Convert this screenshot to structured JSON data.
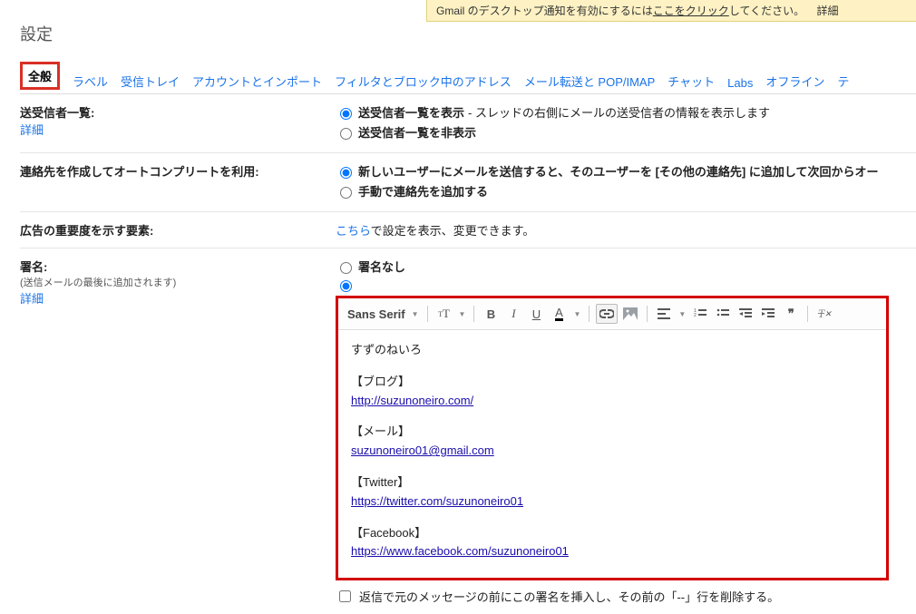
{
  "notif": {
    "prefix": "Gmail のデスクトップ通知を有効にするには",
    "link": "ここをクリック",
    "suffix": "してください。",
    "detail": "詳細"
  },
  "page_title": "設定",
  "tabs": {
    "general": "全般",
    "labels": "ラベル",
    "inbox": "受信トレイ",
    "accounts": "アカウントとインポート",
    "filters": "フィルタとブロック中のアドレス",
    "forwarding": "メール転送と POP/IMAP",
    "chat": "チャット",
    "labs": "Labs",
    "offline": "オフライン",
    "themes": "テ"
  },
  "rows": {
    "people_widget": {
      "label": "送受信者一覧:",
      "detail": "詳細",
      "opt_show_bold": "送受信者一覧を表示",
      "opt_show_desc": " - スレッドの右側にメールの送受信者の情報を表示します",
      "opt_hide": "送受信者一覧を非表示"
    },
    "autocomplete": {
      "label": "連絡先を作成してオートコンプリートを利用:",
      "opt_auto": "新しいユーザーにメールを送信すると、そのユーザーを [その他の連絡先] に追加して次回からオー",
      "opt_manual": "手動で連絡先を追加する"
    },
    "ads": {
      "label": "広告の重要度を示す要素:",
      "link": "こちら",
      "rest": "で設定を表示、変更できます。"
    },
    "signature": {
      "label": "署名:",
      "subnote": "(送信メールの最後に追加されます)",
      "detail": "詳細",
      "opt_none": "署名なし",
      "reply_chk": "返信で元のメッセージの前にこの署名を挿入し、その前の「--」行を削除する。"
    }
  },
  "toolbar": {
    "font_family": "Sans Serif"
  },
  "signature_body": {
    "name_line": "すずのねいろ",
    "blog_head": "【ブログ】",
    "blog_url": "http://suzunoneiro.com/",
    "mail_head": "【メール】",
    "mail_addr": "suzunoneiro01@gmail.com",
    "twitter_head": "【Twitter】",
    "twitter_url": "https://twitter.com/suzunoneiro01",
    "facebook_head": "【Facebook】",
    "facebook_url": "https://www.facebook.com/suzunoneiro01"
  }
}
